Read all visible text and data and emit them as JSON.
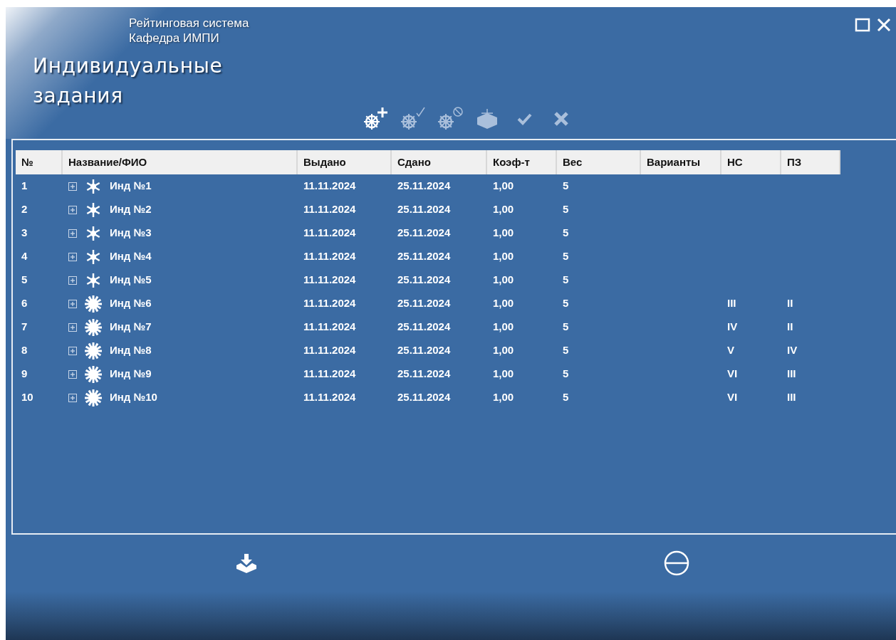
{
  "window": {
    "controls": [
      {
        "kind": "maximize"
      },
      {
        "kind": "close"
      }
    ]
  },
  "header": {
    "subtitle_lines": [
      "Рейтинговая система",
      "Кафедра ИМПИ"
    ],
    "title_lines": [
      "Индивидуальные",
      "задания"
    ]
  },
  "toolbar": [
    {
      "kind": "wheel-add",
      "disabled": false
    },
    {
      "kind": "wheel-check",
      "disabled": true
    },
    {
      "kind": "wheel-block",
      "disabled": true
    },
    {
      "kind": "box",
      "disabled": true
    },
    {
      "kind": "check",
      "disabled": true
    },
    {
      "kind": "cross",
      "disabled": true
    }
  ],
  "table": {
    "columns": [
      "№",
      "Название/ФИО",
      "Выдано",
      "Сдано",
      "Коэф-т",
      "Вес",
      "Варианты",
      "НС",
      "ПЗ"
    ],
    "rows": [
      {
        "no": "1",
        "name": "Инд №1",
        "issued": "11.11.2024",
        "submitted": "25.11.2024",
        "coef": "1,00",
        "weight": "5",
        "kind": "small",
        "expanded": false
      },
      {
        "no": "2",
        "name": "Инд №2",
        "issued": "11.11.2024",
        "submitted": "25.11.2024",
        "coef": "1,00",
        "weight": "5",
        "kind": "small",
        "expanded": false
      },
      {
        "no": "3",
        "name": "Инд №3",
        "issued": "11.11.2024",
        "submitted": "25.11.2024",
        "coef": "1,00",
        "weight": "5",
        "kind": "small",
        "expanded": false
      },
      {
        "no": "4",
        "name": "Инд №4",
        "issued": "11.11.2024",
        "submitted": "25.11.2024",
        "coef": "1,00",
        "weight": "5",
        "kind": "small",
        "expanded": false
      },
      {
        "no": "5",
        "name": "Инд №5",
        "issued": "11.11.2024",
        "submitted": "25.11.2024",
        "coef": "1,00",
        "weight": "5",
        "kind": "small",
        "expanded": false
      },
      {
        "no": "6",
        "name": "Инд №6",
        "issued": "11.11.2024",
        "submitted": "25.11.2024",
        "coef": "1,00",
        "weight": "5",
        "ns": "III",
        "pz": "II",
        "kind": "large",
        "expanded": false
      },
      {
        "no": "7",
        "name": "Инд №7",
        "issued": "11.11.2024",
        "submitted": "25.11.2024",
        "coef": "1,00",
        "weight": "5",
        "ns": "IV",
        "pz": "II",
        "kind": "large",
        "expanded": false
      },
      {
        "no": "8",
        "name": "Инд №8",
        "issued": "11.11.2024",
        "submitted": "25.11.2024",
        "coef": "1,00",
        "weight": "5",
        "ns": "V",
        "pz": "IV",
        "kind": "large",
        "expanded": false
      },
      {
        "no": "9",
        "name": "Инд №9",
        "issued": "11.11.2024",
        "submitted": "25.11.2024",
        "coef": "1,00",
        "weight": "5",
        "ns": "VI",
        "pz": "III",
        "kind": "large",
        "expanded": false
      },
      {
        "no": "10",
        "name": "Инд №10",
        "issued": "11.11.2024",
        "submitted": "25.11.2024",
        "coef": "1,00",
        "weight": "5",
        "ns": "VI",
        "pz": "III",
        "kind": "large",
        "expanded": false
      }
    ]
  },
  "bottom_buttons": [
    {
      "kind": "import"
    },
    {
      "kind": "remove"
    }
  ]
}
